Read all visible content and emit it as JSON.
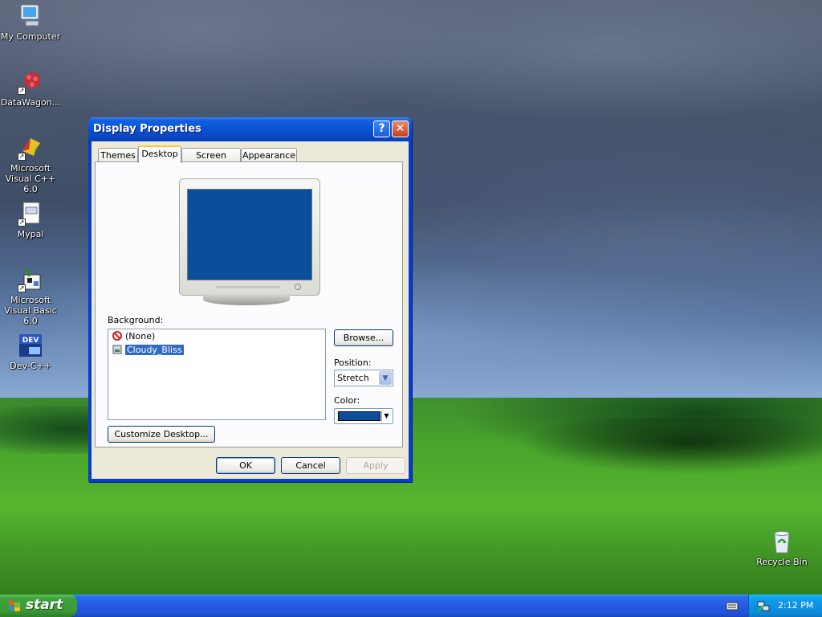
{
  "desktop": {
    "icons": [
      {
        "label": "My Computer"
      },
      {
        "label": "DataWagon..."
      },
      {
        "label": "Microsoft Visual C++ 6.0"
      },
      {
        "label": "Mypal"
      },
      {
        "label": "Microsoft Visual Basic 6.0"
      },
      {
        "label": "Dev-C++"
      },
      {
        "label": "Recycle Bin"
      }
    ]
  },
  "dialog": {
    "title": "Display Properties",
    "help_glyph": "?",
    "close_glyph": "✕",
    "tabs": [
      {
        "label": "Themes"
      },
      {
        "label": "Desktop"
      },
      {
        "label": "Screen Saver"
      },
      {
        "label": "Appearance"
      }
    ],
    "active_tab": "Desktop",
    "background_label": "Background:",
    "background_items": [
      {
        "label": "(None)"
      },
      {
        "label": "Cloudy_Bliss"
      }
    ],
    "selected_background": "Cloudy_Bliss",
    "browse_label": "Browse...",
    "position_label": "Position:",
    "position_value": "Stretch",
    "color_label": "Color:",
    "color_value": "#0b4f9a",
    "customize_label": "Customize Desktop...",
    "ok_label": "OK",
    "cancel_label": "Cancel",
    "apply_label": "Apply"
  },
  "taskbar": {
    "start_label": "start",
    "clock": "2:12 PM"
  }
}
